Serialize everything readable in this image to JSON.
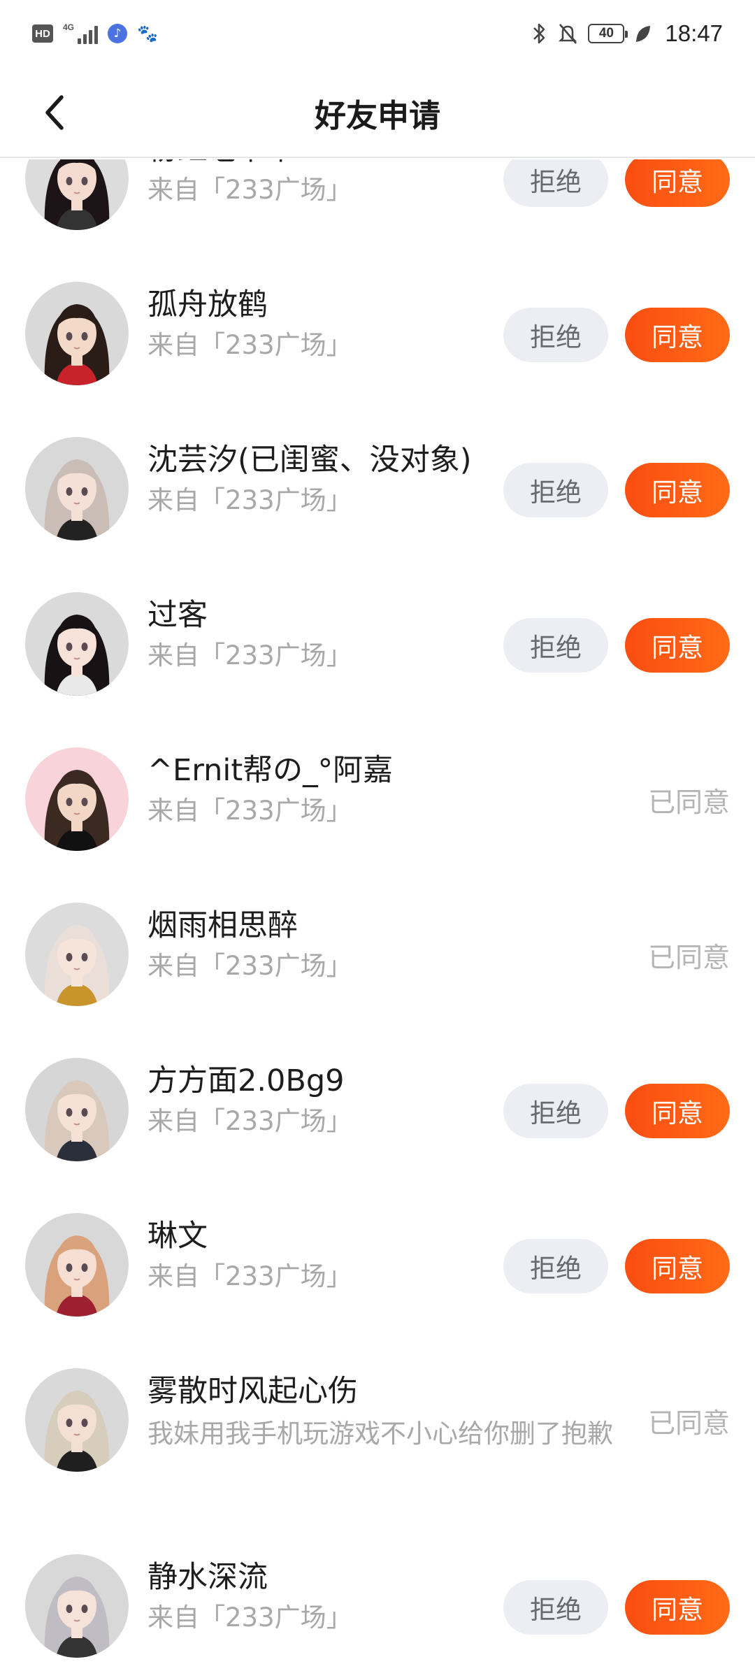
{
  "status_bar": {
    "hd": "HD",
    "network": "4G",
    "time": "18:47",
    "battery": "40"
  },
  "header": {
    "title": "好友申请"
  },
  "requests": [
    {
      "name": "粉红老爷爷",
      "source": "来自「233广场」",
      "status": "pending",
      "reject_label": "拒绝",
      "accept_label": "同意",
      "avatar": {
        "hair": "#1c1416",
        "bg": "#dcdcdc",
        "skin": "#f3dccf",
        "accent": "#333333"
      }
    },
    {
      "name": "孤舟放鹤",
      "source": "来自「233广场」",
      "status": "pending",
      "reject_label": "拒绝",
      "accept_label": "同意",
      "avatar": {
        "hair": "#2a1d18",
        "bg": "#d9d9d9",
        "skin": "#f2d9c8",
        "accent": "#c8232a"
      }
    },
    {
      "name": "沈芸汐(已闺蜜、没对象)",
      "source": "来自「233广场」",
      "status": "pending",
      "reject_label": "拒绝",
      "accept_label": "同意",
      "avatar": {
        "hair": "#c9bdb5",
        "bg": "#d8d8d8",
        "skin": "#f4e0d6",
        "accent": "#222222"
      }
    },
    {
      "name": "过客",
      "source": "来自「233广场」",
      "status": "pending",
      "reject_label": "拒绝",
      "accept_label": "同意",
      "avatar": {
        "hair": "#181214",
        "bg": "#dadada",
        "skin": "#f6e2d8",
        "accent": "#e9e9e9"
      }
    },
    {
      "name": "^Ernit帮の_°阿嘉",
      "source": "来自「233广场」",
      "status": "accepted",
      "accepted_label": "已同意",
      "avatar": {
        "hair": "#3a2a22",
        "bg": "#f8d3da",
        "skin": "#f2d6c6",
        "accent": "#111111"
      }
    },
    {
      "name": "烟雨相思醉",
      "source": "来自「233广场」",
      "status": "accepted",
      "accepted_label": "已同意",
      "avatar": {
        "hair": "#eadfd8",
        "bg": "#dcdcdc",
        "skin": "#f6e4da",
        "accent": "#c8952c"
      }
    },
    {
      "name": "方方面2.0Bg9",
      "source": "来自「233广场」",
      "status": "pending",
      "reject_label": "拒绝",
      "accept_label": "同意",
      "avatar": {
        "hair": "#d9c8bc",
        "bg": "#d6d6d6",
        "skin": "#f5e1d6",
        "accent": "#2b2f3a"
      }
    },
    {
      "name": "琳文",
      "source": "来自「233广场」",
      "status": "pending",
      "reject_label": "拒绝",
      "accept_label": "同意",
      "avatar": {
        "hair": "#d9a27c",
        "bg": "#d8d8d8",
        "skin": "#f6dfd2",
        "accent": "#9d2030"
      }
    },
    {
      "name": "雾散时风起心伤",
      "source": "我妹用我手机玩游戏不小心给你删了抱歉",
      "status": "accepted",
      "accepted_label": "已同意",
      "avatar": {
        "hair": "#d6cdbd",
        "bg": "#d9d9d9",
        "skin": "#f3dfd3",
        "accent": "#1f1f1f"
      }
    },
    {
      "name": "静水深流",
      "source": "来自「233广场」",
      "status": "pending",
      "reject_label": "拒绝",
      "accept_label": "同意",
      "avatar": {
        "hair": "#bfbcc4",
        "bg": "#d8d8d8",
        "skin": "#f5e2d8",
        "accent": "#333333"
      }
    }
  ],
  "colors": {
    "accent": "#fa5512",
    "reject_bg": "#eceef3",
    "muted_text": "#a8a8a8"
  }
}
